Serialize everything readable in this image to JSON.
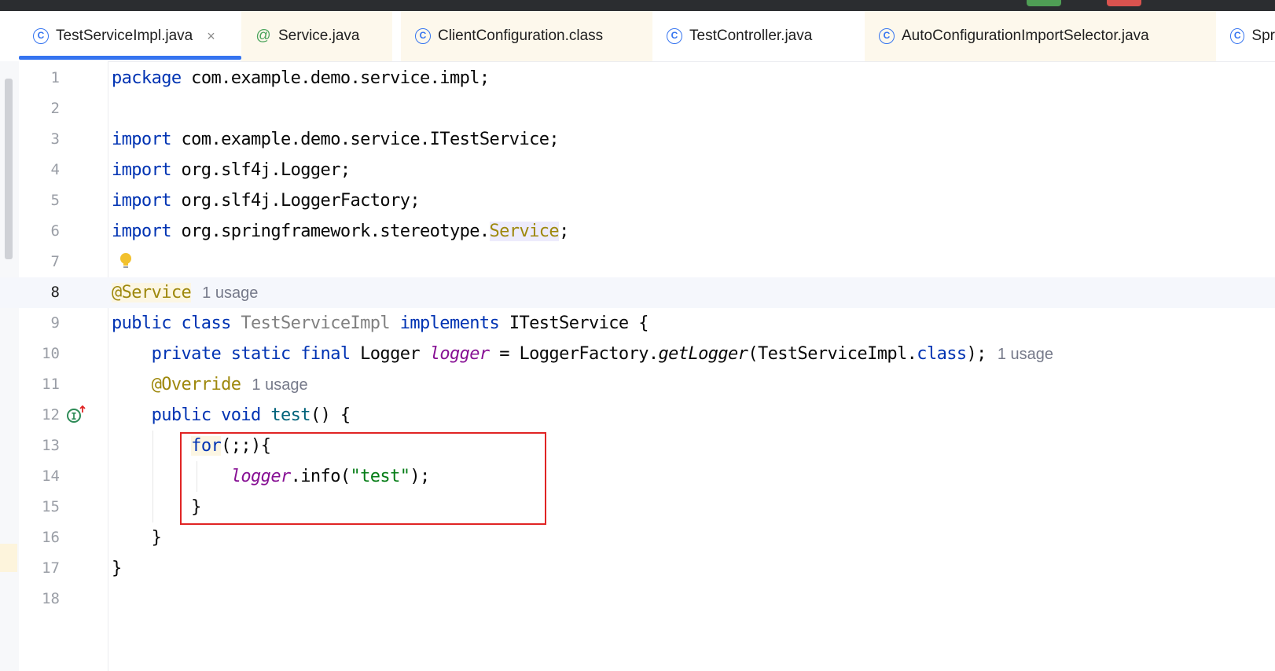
{
  "tabs": [
    {
      "label": "TestServiceImpl.java",
      "icon": "class-c-icon",
      "active": true,
      "close": "×"
    },
    {
      "label": "Service.java",
      "icon": "annotation-at-icon"
    },
    {
      "label": "ClientConfiguration.class",
      "icon": "class-c-icon"
    },
    {
      "label": "TestController.java",
      "icon": "class-c-icon"
    },
    {
      "label": "AutoConfigurationImportSelector.java",
      "icon": "class-c-icon"
    },
    {
      "label": "Spr",
      "icon": "class-run-icon"
    }
  ],
  "lines": {
    "n": [
      "1",
      "2",
      "3",
      "4",
      "5",
      "6",
      "7",
      "8",
      "9",
      "10",
      "11",
      "12",
      "13",
      "14",
      "15",
      "16",
      "17",
      "18"
    ],
    "l1": {
      "kw": "package",
      "rest": " com.example.demo.service.impl;"
    },
    "l3": {
      "kw": "import",
      "rest": " com.example.demo.service.ITestService;"
    },
    "l4": {
      "kw": "import",
      "rest": " org.slf4j.Logger;"
    },
    "l5": {
      "kw": "import",
      "rest": " org.slf4j.LoggerFactory;"
    },
    "l6": {
      "kw": "import",
      "rest": " org.springframework.stereotype.",
      "hl": "Service",
      "end": ";"
    },
    "l8": {
      "ann": "@Service",
      "hint": "1 usage"
    },
    "l9": {
      "kw1": "public class",
      "cls": " TestServiceImpl",
      "kw2": " implements",
      "rest": " ITestService {"
    },
    "l10": {
      "kw": "private static final",
      "t1": " Logger ",
      "fld": "logger",
      "t2": " = LoggerFactory.",
      "mth": "getLogger",
      "t3": "(TestServiceImpl.",
      "kw2": "class",
      "t4": ");",
      "hint": "1 usage"
    },
    "l11": {
      "ann": "@Override",
      "hint": "1 usage"
    },
    "l12": {
      "kw": "public void",
      "mth": " test",
      "rest": "() {"
    },
    "l13": {
      "kw": "for",
      "rest": "(;;){"
    },
    "l14": {
      "fld": "logger",
      "t1": ".info(",
      "str": "\"test\"",
      "t2": ");"
    },
    "l15": "}",
    "l16": "}",
    "l17": "}"
  }
}
